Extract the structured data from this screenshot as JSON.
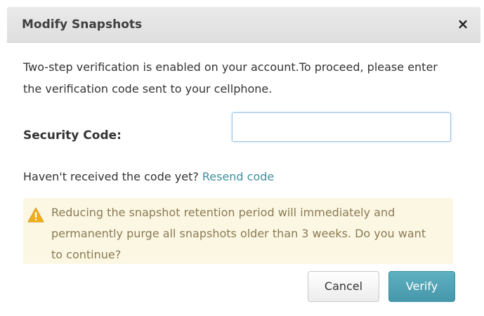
{
  "dialog": {
    "title": "Modify Snapshots",
    "close_label": "×",
    "intro_text": "Two-step verification is enabled on your account.To proceed, please enter the verification code sent to your cellphone.",
    "security_code": {
      "label": "Security Code:",
      "value": "",
      "placeholder": ""
    },
    "resend": {
      "prompt": "Haven't received the code yet?",
      "link_label": "Resend code"
    },
    "warning": {
      "icon": "warning-triangle-icon",
      "text": "Reducing the snapshot retention period will immediately and permanently purge all snapshots older than 3 weeks. Do you want to continue?"
    },
    "buttons": {
      "cancel_label": "Cancel",
      "verify_label": "Verify"
    }
  },
  "colors": {
    "header_bg": "#e4e4e4",
    "link": "#3e8f9c",
    "warning_bg": "#fcf7e3",
    "warning_text": "#8a7a55",
    "warning_icon": "#f0ad1e",
    "primary_button": "#4fa3b6",
    "input_focus_border": "#9cc3e8"
  }
}
